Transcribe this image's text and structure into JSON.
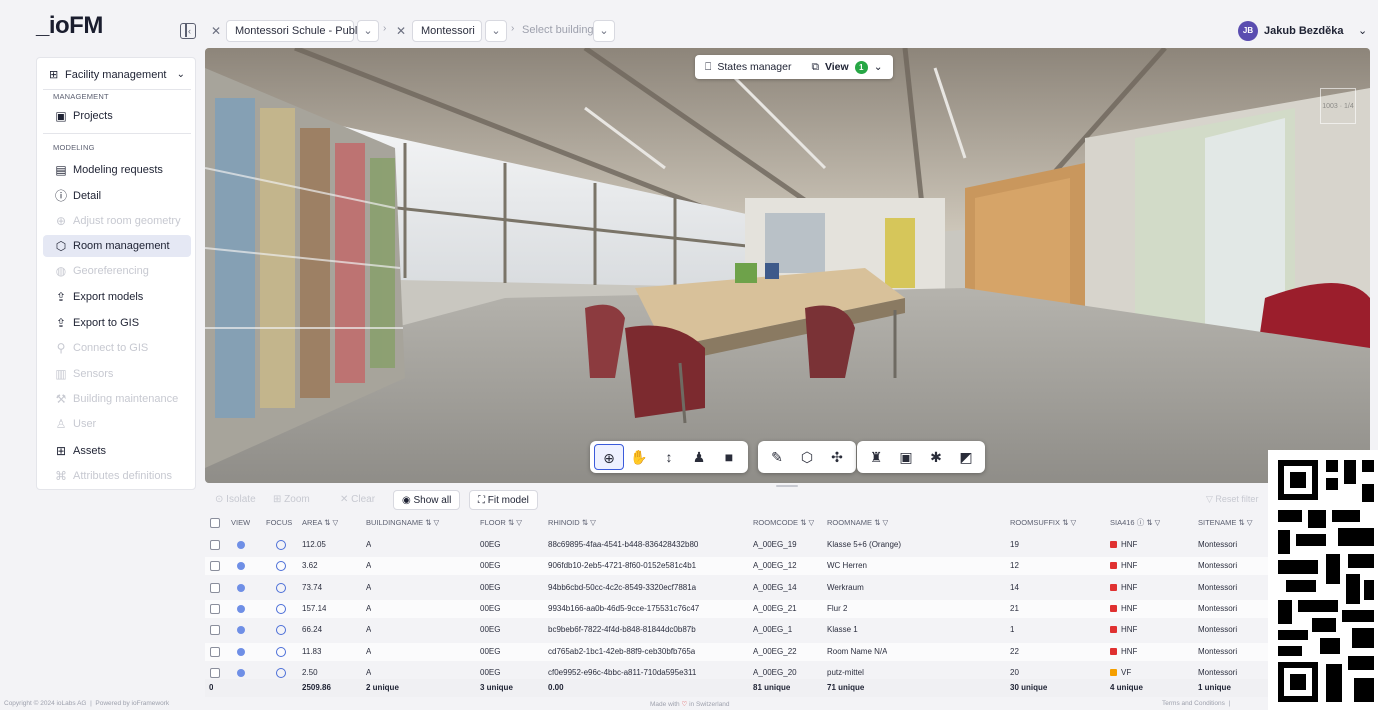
{
  "app": {
    "logo": "_ioFM"
  },
  "header": {
    "crumbs": [
      {
        "label": "Montessori Schule - Public"
      },
      {
        "label": "Montessori"
      },
      {
        "label": "Select building"
      }
    ],
    "user": {
      "initials": "JB",
      "name": "Jakub Bezděka"
    }
  },
  "sidebar": {
    "module": "Facility management",
    "sections": {
      "management": "MANAGEMENT",
      "modeling": "MODELING"
    },
    "items": {
      "projects": "Projects",
      "modeling_requests": "Modeling requests",
      "detail": "Detail",
      "adjust_room_geometry": "Adjust room geometry",
      "room_management": "Room management",
      "georeferencing": "Georeferencing",
      "export_models": "Export models",
      "export_to_gis": "Export to GIS",
      "connect_to_gis": "Connect to GIS",
      "sensors": "Sensors",
      "building_maintenance": "Building maintenance",
      "user": "User",
      "assets": "Assets",
      "attributes_definitions": "Attributes definitions"
    }
  },
  "viewer": {
    "states_manager": "States manager",
    "view_label": "View",
    "view_badge": "1"
  },
  "table_actions": {
    "isolate": "Isolate",
    "zoom": "Zoom",
    "clear": "Clear",
    "show_all": "Show all",
    "fit_model": "Fit model",
    "reset_filter": "Reset filter"
  },
  "columns": [
    "VIEW",
    "FOCUS",
    "AREA",
    "BUILDINGNAME",
    "FLOOR",
    "RHINOID",
    "ROOMCODE",
    "ROOMNAME",
    "ROOMSUFFIX",
    "SIA416",
    "SITENAME"
  ],
  "rows": [
    {
      "area": "112.05",
      "building": "A",
      "floor": "00EG",
      "rhinoid": "88c69895-4faa-4541-b448-836428432b80",
      "roomcode": "A_00EG_19",
      "roomname": "Klasse 5+6 (Orange)",
      "suffix": "19",
      "sia": "HNF",
      "site": "Montessori"
    },
    {
      "area": "3.62",
      "building": "A",
      "floor": "00EG",
      "rhinoid": "906fdb10-2eb5-4721-8f60-0152e581c4b1",
      "roomcode": "A_00EG_12",
      "roomname": "WC Herren",
      "suffix": "12",
      "sia": "HNF",
      "site": "Montessori"
    },
    {
      "area": "73.74",
      "building": "A",
      "floor": "00EG",
      "rhinoid": "94bb6cbd-50cc-4c2c-8549-3320ecf7881a",
      "roomcode": "A_00EG_14",
      "roomname": "Werkraum",
      "suffix": "14",
      "sia": "HNF",
      "site": "Montessori"
    },
    {
      "area": "157.14",
      "building": "A",
      "floor": "00EG",
      "rhinoid": "9934b166-aa0b-46d5-9cce-175531c76c47",
      "roomcode": "A_00EG_21",
      "roomname": "Flur 2",
      "suffix": "21",
      "sia": "HNF",
      "site": "Montessori"
    },
    {
      "area": "66.24",
      "building": "A",
      "floor": "00EG",
      "rhinoid": "bc9beb6f-7822-4f4d-b848-81844dc0b87b",
      "roomcode": "A_00EG_1",
      "roomname": "Klasse 1",
      "suffix": "1",
      "sia": "HNF",
      "site": "Montessori"
    },
    {
      "area": "11.83",
      "building": "A",
      "floor": "00EG",
      "rhinoid": "cd765ab2-1bc1-42eb-88f9-ceb30bfb765a",
      "roomcode": "A_00EG_22",
      "roomname": "Room Name N/A",
      "suffix": "22",
      "sia": "HNF",
      "site": "Montessori"
    },
    {
      "area": "2.50",
      "building": "A",
      "floor": "00EG",
      "rhinoid": "cf0e9952-e96c-4bbc-a811-710da595e311",
      "roomcode": "A_00EG_20",
      "roomname": "putz-mittel",
      "suffix": "20",
      "sia": "VF",
      "site": "Montessori"
    }
  ],
  "totals": {
    "count": "0",
    "area": "2509.86",
    "building": "2 unique",
    "floor": "3 unique",
    "rhinoid": "0.00",
    "roomcode": "81 unique",
    "roomname": "71 unique",
    "suffix": "30 unique",
    "sia": "4 unique",
    "site": "1 unique"
  },
  "colors": {
    "hnf": "#e03131",
    "vf": "#f59f00",
    "accent": "#3b5bdb"
  },
  "footer": {
    "copyright": "Copyright © 2024 ioLabs AG",
    "powered": "Powered by ioFramework",
    "made_with": "Made with",
    "in_switzerland": "in Switzerland",
    "terms": "Terms and Conditions"
  }
}
